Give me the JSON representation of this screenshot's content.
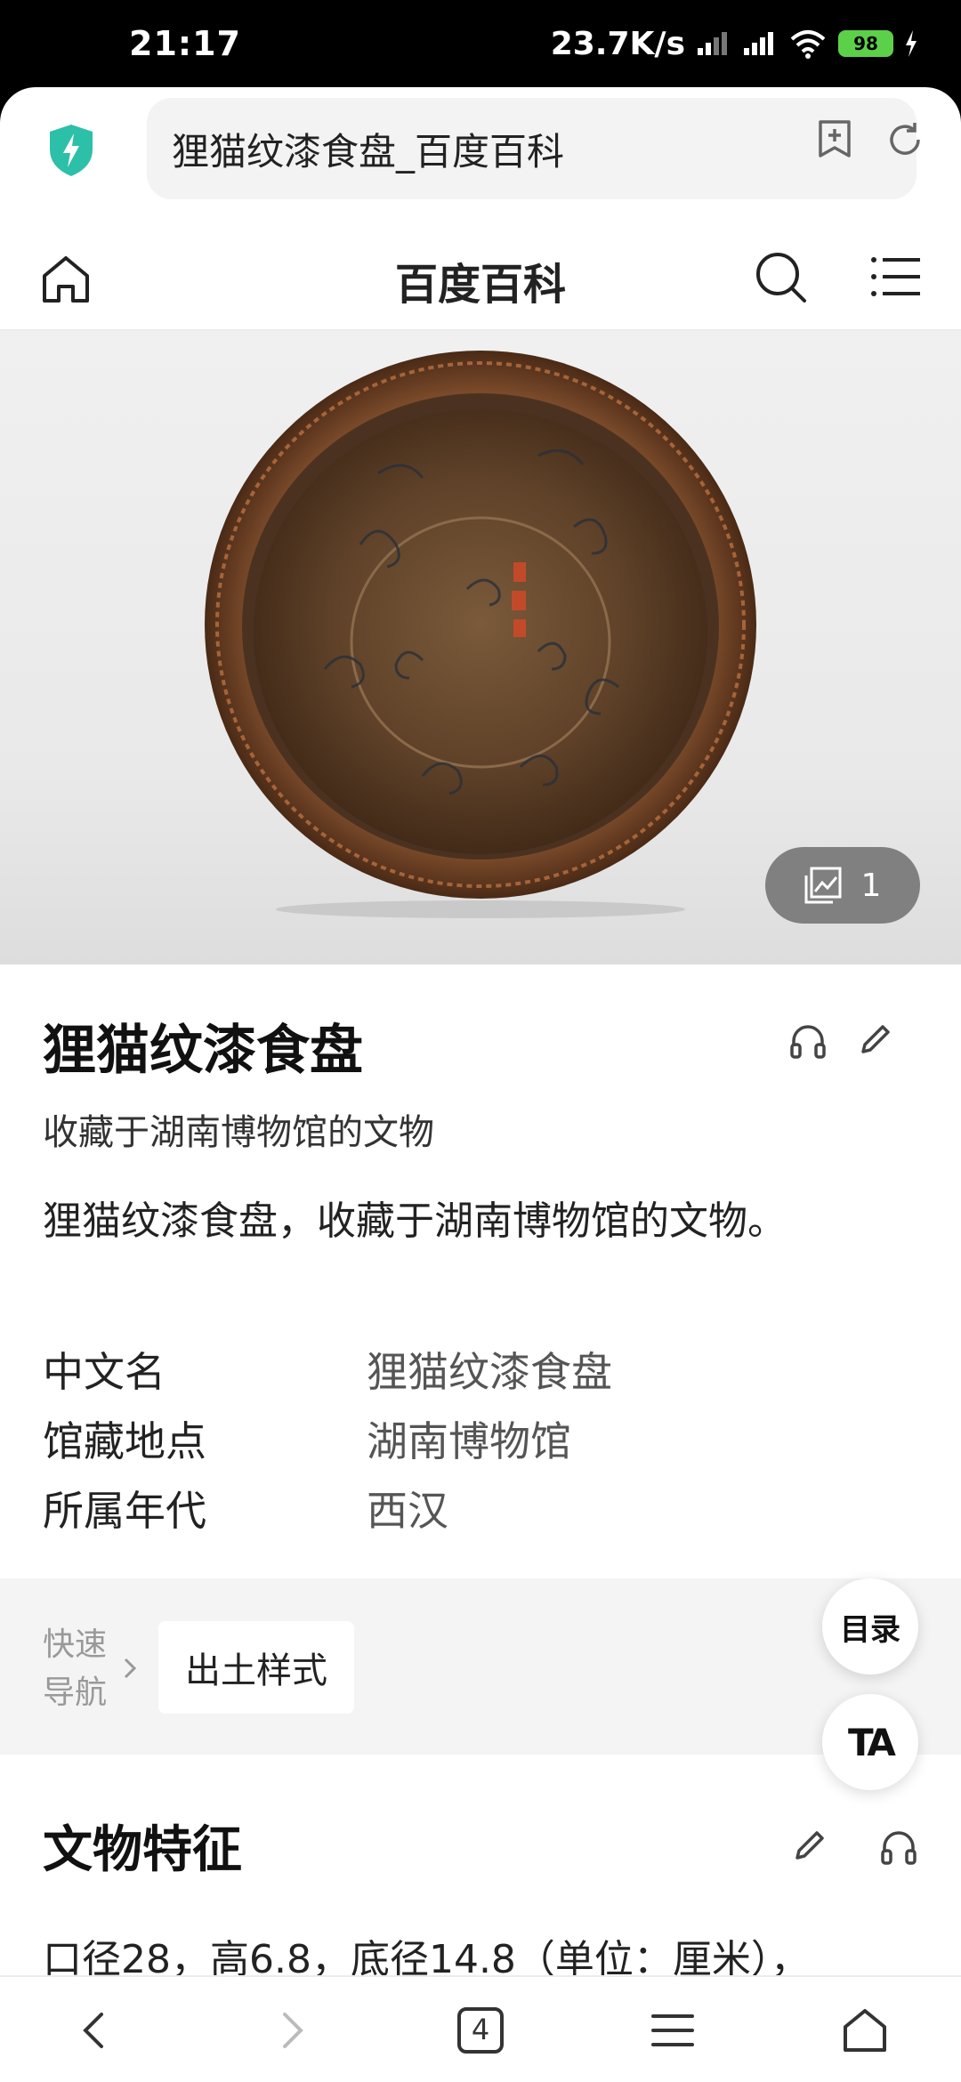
{
  "status_bar": {
    "time": "21:17",
    "net_speed": "23.7K/s",
    "battery": "98"
  },
  "browser": {
    "url_title": "狸猫纹漆食盘_百度百科",
    "tabs_count": "4"
  },
  "site": {
    "title": "百度百科"
  },
  "hero": {
    "image_count": "1"
  },
  "entry": {
    "title": "狸猫纹漆食盘",
    "subtitle": "收藏于湖南博物馆的文物",
    "summary": "狸猫纹漆食盘，收藏于湖南博物馆的文物。",
    "info": [
      {
        "key": "中文名",
        "value": "狸猫纹漆食盘"
      },
      {
        "key": "馆藏地点",
        "value": "湖南博物馆"
      },
      {
        "key": "所属年代",
        "value": "西汉"
      }
    ]
  },
  "quick_nav": {
    "label_line1": "快速",
    "label_line2": "导航",
    "chip": "出土样式"
  },
  "floating": {
    "toc": "目录",
    "font": "TA"
  },
  "section": {
    "title": "文物特征",
    "text": "口径28，高6.8，底径14.8（单位：厘米），"
  },
  "colors": {
    "shield": "#2cc0a8",
    "battery": "#5dd04a"
  }
}
